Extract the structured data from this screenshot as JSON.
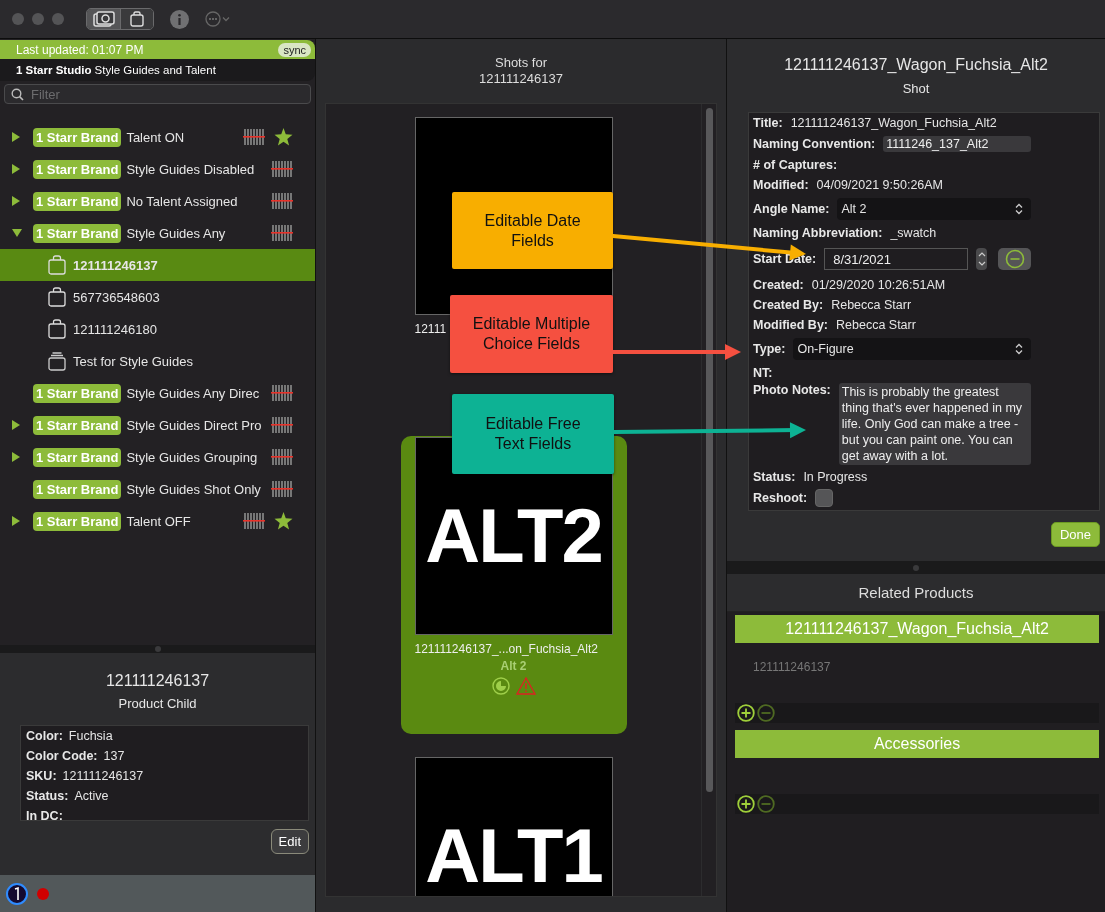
{
  "toolbar": {
    "segments": [
      {
        "kind": "camera",
        "selected": true
      },
      {
        "kind": "bag",
        "selected": false
      }
    ]
  },
  "sidebar": {
    "last_updated": "Last updated: 01:07 PM",
    "sync": "sync",
    "studio": "**1 Starr Studio** Style Guides and Talent",
    "filter": {
      "placeholder": "Filter"
    },
    "tree": [
      {
        "kind": "brand",
        "badge": "1 Starr Brand",
        "label": "Talent ON",
        "expandable": true,
        "expanded": false,
        "starred": true,
        "selected": false
      },
      {
        "kind": "brand",
        "badge": "1 Starr Brand",
        "label": "Style Guides Disabled",
        "expandable": true,
        "expanded": false,
        "starred": false,
        "selected": false
      },
      {
        "kind": "brand",
        "badge": "1 Starr Brand",
        "label": "No Talent Assigned",
        "expandable": true,
        "expanded": false,
        "starred": false,
        "selected": false
      },
      {
        "kind": "brand",
        "badge": "1 Starr Brand",
        "label": "Style Guides Any",
        "expandable": true,
        "expanded": true,
        "starred": false,
        "selected": false,
        "children": [
          {
            "kind": "product",
            "label": "121111246137",
            "selected": true
          },
          {
            "kind": "product",
            "label": "567736548603",
            "selected": false
          },
          {
            "kind": "product",
            "label": "121111246180",
            "selected": false
          },
          {
            "kind": "group",
            "label": "Test for Style Guides",
            "selected": false
          }
        ]
      },
      {
        "kind": "brand",
        "badge": "1 Starr Brand",
        "label": "Style Guides Any Direc",
        "expandable": false,
        "starred": false,
        "selected": false
      },
      {
        "kind": "brand",
        "badge": "1 Starr Brand",
        "label": "Style Guides Direct Pro",
        "expandable": true,
        "expanded": false,
        "starred": false,
        "selected": false
      },
      {
        "kind": "brand",
        "badge": "1 Starr Brand",
        "label": "Style Guides Grouping",
        "expandable": true,
        "expanded": false,
        "starred": false,
        "selected": false
      },
      {
        "kind": "brand",
        "badge": "1 Starr Brand",
        "label": "Style Guides Shot Only",
        "expandable": false,
        "starred": false,
        "selected": false
      },
      {
        "kind": "brand",
        "badge": "1 Starr Brand",
        "label": "Talent OFF",
        "expandable": true,
        "expanded": false,
        "starred": true,
        "selected": false
      }
    ]
  },
  "product_panel": {
    "title": "121111246137",
    "subtitle": "Product Child",
    "fields": [
      {
        "label": "Color:",
        "value": "Fuchsia"
      },
      {
        "label": "Color Code:",
        "value": "137"
      },
      {
        "label": "SKU:",
        "value": "121111246137"
      },
      {
        "label": "Status:",
        "value": "Active"
      },
      {
        "label": "In DC:"
      }
    ],
    "edit": "Edit"
  },
  "shots": {
    "title": "Shots for",
    "subtitle": "121111246137",
    "cards": [
      {
        "caption": "12111",
        "selected": false
      },
      {
        "image_text": "ALT2",
        "caption": "121111246137_...on_Fuchsia_Alt2",
        "angle": "Alt 2",
        "warning": true,
        "selected": true
      },
      {
        "image_text": "ALT1",
        "selected": false
      }
    ]
  },
  "callouts": [
    {
      "text": "Editable Date\nFields",
      "color": "#f8ae00"
    },
    {
      "text": "Editable Multiple\nChoice Fields",
      "color": "#f55040"
    },
    {
      "text": "Editable Free\nText Fields",
      "color": "#0db294"
    }
  ],
  "shot_detail": {
    "title": "121111246137_Wagon_Fuchsia_Alt2",
    "subtitle": "Shot",
    "fields": [
      {
        "kind": "text",
        "label": "Title:",
        "value": "121111246137_Wagon_Fuchsia_Alt2"
      },
      {
        "kind": "input",
        "label": "Naming Convention:",
        "value": "1111246_137_Alt2"
      },
      {
        "kind": "text",
        "label": "# of Captures:"
      },
      {
        "kind": "text",
        "label": "Modified:",
        "value": "04/09/2021 9:50:26AM"
      },
      {
        "kind": "select",
        "label": "Angle Name:",
        "value": "Alt 2"
      },
      {
        "kind": "text",
        "label": "Naming Abbreviation:",
        "value": "_swatch"
      },
      {
        "kind": "date",
        "label": "Start Date:",
        "value": "8/31/2021"
      },
      {
        "kind": "text",
        "label": "Created:",
        "value": "01/29/2020 10:26:51AM"
      },
      {
        "kind": "text",
        "label": "Created By:",
        "value": "Rebecca Starr"
      },
      {
        "kind": "text",
        "label": "Modified By:",
        "value": "Rebecca Starr"
      },
      {
        "kind": "select",
        "label": "Type:",
        "value": "On-Figure"
      },
      {
        "kind": "text",
        "label": "NT:"
      },
      {
        "kind": "textarea",
        "label": "Photo Notes:",
        "value": "This is probably the greatest thing that's ever happened in my life. Only God can make a tree - but you can paint one. You can get away with a lot."
      },
      {
        "kind": "text",
        "label": "Status:",
        "value": "In Progress"
      },
      {
        "kind": "checkbox",
        "label": "Reshoot:",
        "checked": false
      }
    ],
    "done": "Done"
  },
  "related": {
    "title": "Related Products",
    "groups": [
      {
        "header": "121111246137_Wagon_Fuchsia_Alt2",
        "items": [
          "121111246137"
        ],
        "can_remove": false
      },
      {
        "header": "Accessories",
        "can_remove": false
      }
    ]
  }
}
